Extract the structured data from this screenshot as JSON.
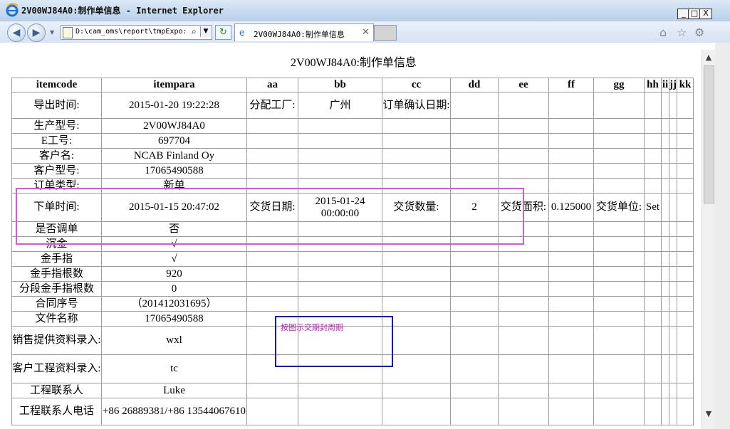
{
  "window": {
    "title": "2V00WJ84A0:制作单信息 - Internet Explorer",
    "buttons": {
      "minimize": "_",
      "maximize": "□",
      "close": "X"
    }
  },
  "browser": {
    "address": "D:\\cam_oms\\report\\tmpExpo:",
    "tab_label": "2V00WJ84A0:制作单信息",
    "tab_close": "✕",
    "icons": {
      "back": "◀",
      "forward": "▶",
      "dropdown": "▼",
      "search": "⌕",
      "refresh": "↻",
      "home": "⌂",
      "favorites": "☆",
      "settings": "⚙"
    }
  },
  "page": {
    "title": "2V00WJ84A0:制作单信息"
  },
  "table": {
    "headers": [
      "itemcode",
      "itempara",
      "aa",
      "bb",
      "cc",
      "dd",
      "ee",
      "ff",
      "gg",
      "hh",
      "ii",
      "jj",
      "kk"
    ],
    "rows": [
      [
        "导出时间:",
        "2015-01-20 19:22:28",
        "分配工厂:",
        "广州",
        "订单确认日期:",
        "",
        "",
        "",
        "",
        "",
        "",
        "",
        ""
      ],
      [
        "生产型号:",
        "2V00WJ84A0",
        "",
        "",
        "",
        "",
        "",
        "",
        "",
        "",
        "",
        "",
        ""
      ],
      [
        "E工号:",
        "697704",
        "",
        "",
        "",
        "",
        "",
        "",
        "",
        "",
        "",
        "",
        ""
      ],
      [
        "客户名:",
        "NCAB Finland Oy",
        "",
        "",
        "",
        "",
        "",
        "",
        "",
        "",
        "",
        "",
        ""
      ],
      [
        "客户型号:",
        "17065490588",
        "",
        "",
        "",
        "",
        "",
        "",
        "",
        "",
        "",
        "",
        ""
      ],
      [
        "订单类型:",
        "新单",
        "",
        "",
        "",
        "",
        "",
        "",
        "",
        "",
        "",
        "",
        ""
      ],
      [
        "下单时间:",
        "2015-01-15 20:47:02",
        "交货日期:",
        "2015-01-24 00:00:00",
        "交货数量:",
        "2",
        "交货面积:",
        "0.125000",
        "交货单位:",
        "Set",
        "",
        "",
        ""
      ],
      [
        "是否调单",
        "否",
        "",
        "",
        "",
        "",
        "",
        "",
        "",
        "",
        "",
        "",
        ""
      ],
      [
        "沉金",
        "√",
        "",
        "",
        "",
        "",
        "",
        "",
        "",
        "",
        "",
        "",
        ""
      ],
      [
        "金手指",
        "√",
        "",
        "",
        "",
        "",
        "",
        "",
        "",
        "",
        "",
        "",
        ""
      ],
      [
        "金手指根数",
        "920",
        "",
        "",
        "",
        "",
        "",
        "",
        "",
        "",
        "",
        "",
        ""
      ],
      [
        "分段金手指根数",
        "0",
        "",
        "",
        "",
        "",
        "",
        "",
        "",
        "",
        "",
        "",
        ""
      ],
      [
        "合同序号",
        "（201412031695）",
        "",
        "",
        "",
        "",
        "",
        "",
        "",
        "",
        "",
        "",
        ""
      ],
      [
        "文件名称",
        "17065490588",
        "",
        "",
        "",
        "",
        "",
        "",
        "",
        "",
        "",
        "",
        ""
      ],
      [
        "销售提供资料录入:",
        "wxl",
        "",
        "",
        "",
        "",
        "",
        "",
        "",
        "",
        "",
        "",
        ""
      ],
      [
        "客户工程资料录入:",
        "tc",
        "",
        "",
        "",
        "",
        "",
        "",
        "",
        "",
        "",
        "",
        ""
      ],
      [
        "工程联系人",
        "Luke",
        "",
        "",
        "",
        "",
        "",
        "",
        "",
        "",
        "",
        "",
        ""
      ],
      [
        "工程联系人电话",
        "+86 26889381/+86 13544067610",
        "",
        "",
        "",
        "",
        "",
        "",
        "",
        "",
        "",
        "",
        ""
      ]
    ]
  },
  "annotations": {
    "blue_note": "按图示交期封周期",
    "magenta_color": "#d45ad8",
    "blue_color": "#1414b4"
  },
  "scrollbar": {
    "up": "▲",
    "down": "▼"
  }
}
